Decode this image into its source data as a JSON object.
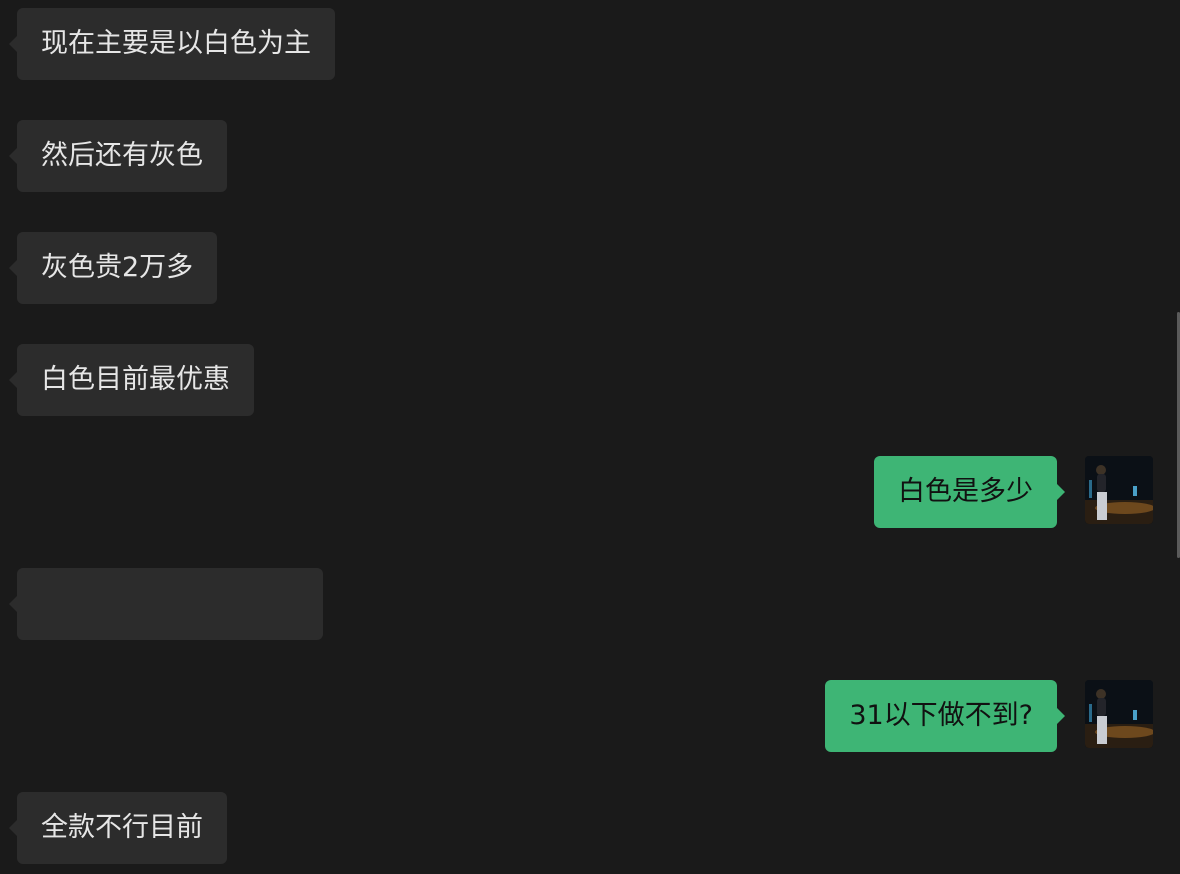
{
  "messages": [
    {
      "direction": "in",
      "text": "现在主要是以白色为主"
    },
    {
      "direction": "in",
      "text": "然后还有灰色"
    },
    {
      "direction": "in",
      "text": "灰色贵2万多"
    },
    {
      "direction": "in",
      "text": "白色目前最优惠"
    },
    {
      "direction": "out",
      "text": "白色是多少"
    },
    {
      "direction": "in",
      "text": ""
    },
    {
      "direction": "out",
      "text": "31以下做不到?"
    },
    {
      "direction": "in",
      "text": "全款不行目前"
    }
  ],
  "colors": {
    "background": "#1a1a1a",
    "incoming_bubble": "#2c2c2c",
    "outgoing_bubble": "#3eb575",
    "incoming_text": "#e6e6e6",
    "outgoing_text": "#111111"
  },
  "icons": {
    "avatar": "user-avatar-photo"
  }
}
